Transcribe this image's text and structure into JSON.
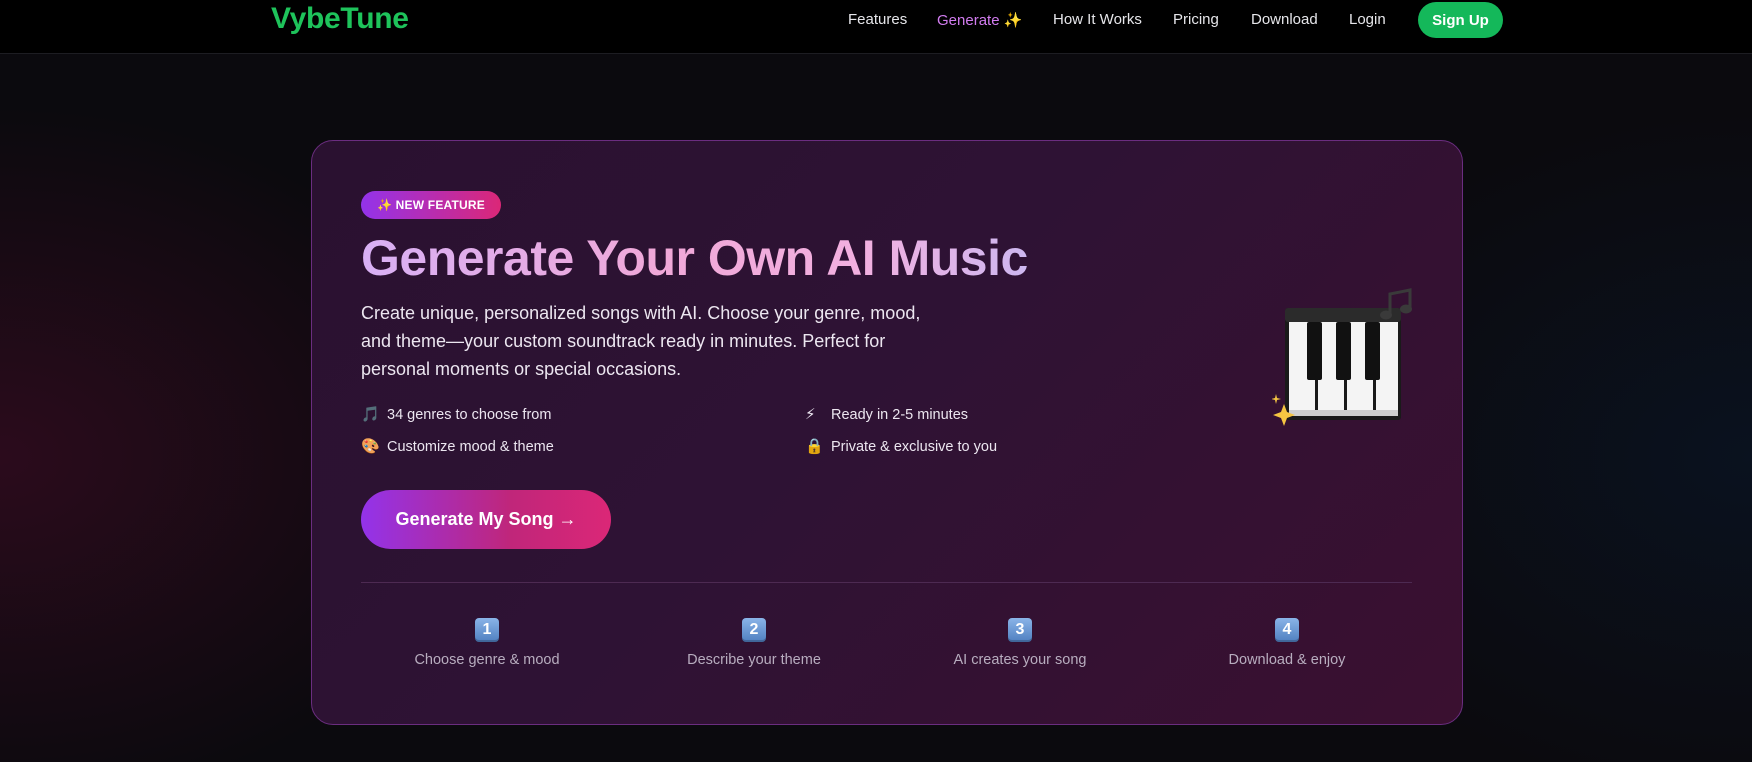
{
  "nav": {
    "logo": "VybeTune",
    "links": [
      {
        "label": "Features"
      },
      {
        "label": "Generate ✨"
      },
      {
        "label": "How It Works"
      },
      {
        "label": "Pricing"
      },
      {
        "label": "Download"
      },
      {
        "label": "Login"
      }
    ],
    "signup": "Sign Up"
  },
  "hero": {
    "badge": "✨ NEW FEATURE",
    "title": "Generate Your Own AI Music",
    "description": "Create unique, personalized songs with AI. Choose your genre, mood, and theme—your custom soundtrack ready in minutes. Perfect for personal moments or special occasions.",
    "features": [
      {
        "icon": "🎵",
        "icon_name": "music-note-icon",
        "label": "34 genres to choose from"
      },
      {
        "icon": "⚡",
        "icon_name": "lightning-icon",
        "label": "Ready in 2-5 minutes"
      },
      {
        "icon": "🎨",
        "icon_name": "palette-icon",
        "label": "Customize mood & theme"
      },
      {
        "icon": "🔒",
        "icon_name": "lock-icon",
        "label": "Private & exclusive to you"
      }
    ],
    "cta": "Generate My Song →"
  },
  "steps": [
    {
      "num": "1",
      "label": "Choose genre & mood"
    },
    {
      "num": "2",
      "label": "Describe your theme"
    },
    {
      "num": "3",
      "label": "AI creates your song"
    },
    {
      "num": "4",
      "label": "Download & enjoy"
    }
  ],
  "colors": {
    "brand_green": "#1ec35b",
    "accent_purple": "#9333ea",
    "accent_pink": "#db2777",
    "active_nav": "#d27cf0"
  }
}
